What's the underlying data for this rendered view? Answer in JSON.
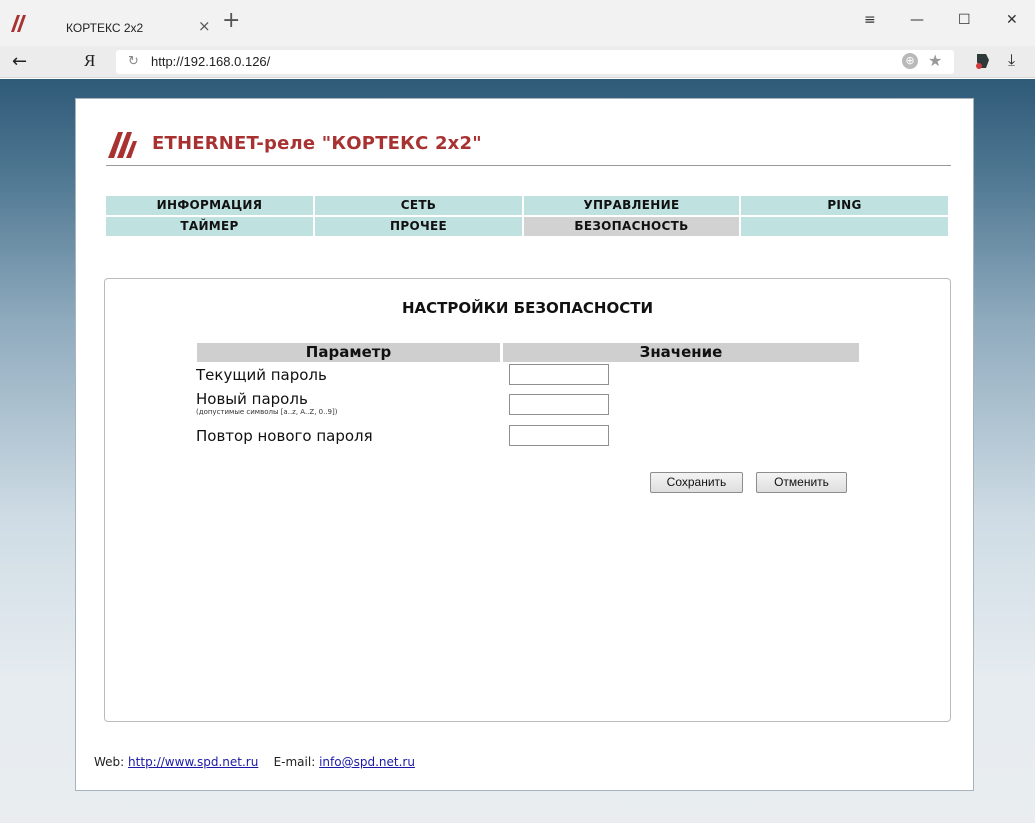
{
  "browser": {
    "tab_title": "КОРТЕКС 2x2",
    "tab_close": "×",
    "new_tab": "+",
    "menu_glyph": "≡",
    "minimize": "—",
    "maximize": "☐",
    "close": "✕",
    "back": "←",
    "yandex": "Я",
    "reload": "↻",
    "url": "http://192.168.0.126/",
    "protect": "⊕",
    "bookmark": "★",
    "download": "⤓"
  },
  "page": {
    "title": "ETHERNET-реле \"КОРТЕКС 2x2\"",
    "menu": {
      "row1": [
        "ИНФОРМАЦИЯ",
        "СЕТЬ",
        "УПРАВЛЕНИЕ",
        "PING"
      ],
      "row2": [
        "ТАЙМЕР",
        "ПРОЧЕЕ",
        "БЕЗОПАСНОСТЬ",
        ""
      ],
      "active": "БЕЗОПАСНОСТЬ"
    },
    "settings": {
      "title": "НАСТРОЙКИ БЕЗОПАСНОСТИ",
      "col_param": "Параметр",
      "col_value": "Значение",
      "current_password": "Текущий пароль",
      "new_password": "Новый пароль",
      "new_password_hint": "(допустимые символы [a..z, A..Z, 0..9])",
      "repeat_password": "Повтор нового пароля",
      "current_password_value": "",
      "new_password_value": "",
      "repeat_password_value": "",
      "save": "Сохранить",
      "cancel": "Отменить"
    },
    "footer": {
      "web_label": "Web:",
      "web_link": "http://www.spd.net.ru",
      "email_label": "E-mail:",
      "email_link": "info@spd.net.ru"
    }
  },
  "colors": {
    "brand_red": "#a83232",
    "menu_bg": "#bfe2e1",
    "menu_active_bg": "#d2d2d2",
    "header_bg": "#cfcfcf"
  }
}
